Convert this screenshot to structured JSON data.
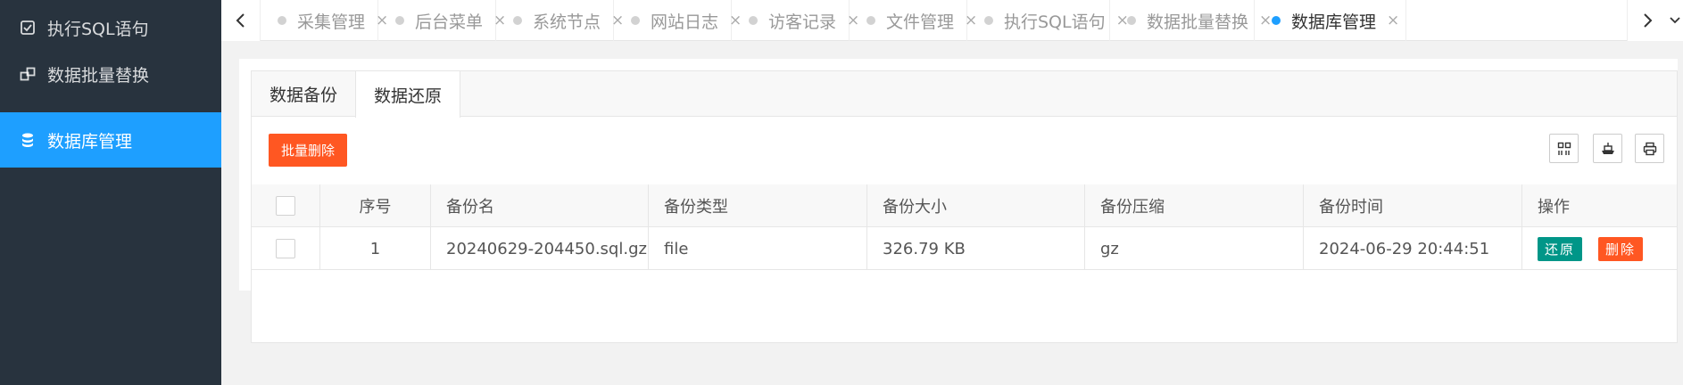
{
  "sidebar": {
    "items": [
      {
        "label": "执行SQL语句",
        "icon": "checkbox-icon"
      },
      {
        "label": "数据批量替换",
        "icon": "replace-icon"
      },
      {
        "label": "数据库管理",
        "icon": "database-icon",
        "active": true
      }
    ]
  },
  "tabs": [
    {
      "label": "采集管理"
    },
    {
      "label": "后台菜单"
    },
    {
      "label": "系统节点"
    },
    {
      "label": "网站日志"
    },
    {
      "label": "访客记录"
    },
    {
      "label": "文件管理"
    },
    {
      "label": "执行SQL语句"
    },
    {
      "label": "数据批量替换"
    },
    {
      "label": "数据库管理",
      "active": true
    }
  ],
  "tab_close_glyph": "×",
  "panel": {
    "tabs": [
      {
        "label": "数据备份"
      },
      {
        "label": "数据还原",
        "active": true
      }
    ],
    "batch_delete_label": "批量删除",
    "toolbar_icons": [
      "columns-icon",
      "export-icon",
      "print-icon"
    ]
  },
  "table": {
    "headers": [
      "序号",
      "备份名",
      "备份类型",
      "备份大小",
      "备份压缩",
      "备份时间",
      "操作"
    ],
    "rows": [
      {
        "index": "1",
        "name": "20240629-204450.sql.gz",
        "type": "file",
        "size": "326.79 KB",
        "compress": "gz",
        "time": "2024-06-29 20:44:51",
        "restore_label": "还原",
        "delete_label": "删除"
      }
    ]
  },
  "colors": {
    "sidebar_bg": "#28333e",
    "accent": "#1e9fff",
    "danger": "#ff5722",
    "success": "#009688"
  }
}
